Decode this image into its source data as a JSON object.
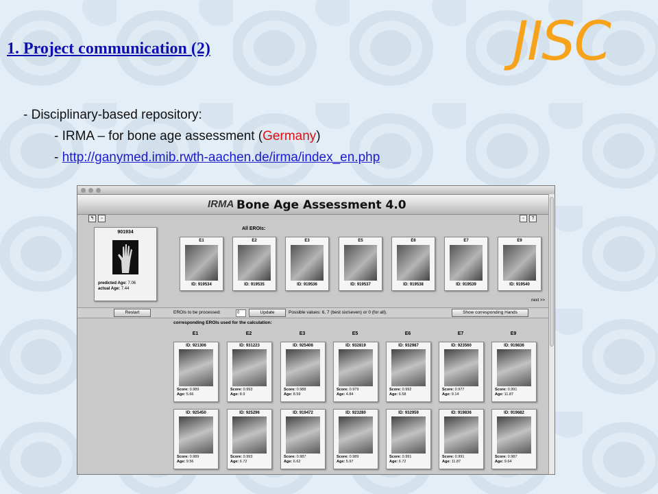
{
  "slide": {
    "title": "1. Project communication (2)",
    "logo_text": "JISC",
    "bullet1": "-  Disciplinary-based  repository:",
    "bullet2_pre": "- IRMA – for bone age assessment (",
    "bullet2_red": "Germany",
    "bullet2_post": ")",
    "bullet3_dash": "- ",
    "bullet3_link": "http://ganymed.imib.rwth-aachen.de/irma/index_en.php",
    "colors": {
      "title": "#1010b0",
      "logo": "#f7a21b",
      "red": "#e01010",
      "link": "#1a1ad0"
    }
  },
  "app": {
    "logo": "IRMA",
    "title": "Bone Age Assessment 4.0",
    "toolbar_icons": [
      "back-icon",
      "print-icon",
      "settings-icon",
      "help-icon"
    ],
    "patient": {
      "id": "901934",
      "predicted_label": "predicted Age:",
      "predicted": "7.06",
      "actual_label": "actual Age:",
      "actual": "7.44"
    },
    "all_erois_label": "All EROIs:",
    "erois": [
      {
        "label": "E1",
        "id": "ID: 919534"
      },
      {
        "label": "E2",
        "id": "ID: 919535"
      },
      {
        "label": "E3",
        "id": "ID: 919536"
      },
      {
        "label": "E5",
        "id": "ID: 919537"
      },
      {
        "label": "E6",
        "id": "ID: 919538"
      },
      {
        "label": "E7",
        "id": "ID: 919539"
      },
      {
        "label": "E9",
        "id": "ID: 919540"
      }
    ],
    "next": "next >>",
    "restart": "Restart",
    "process_label": "EROIs to be processed:",
    "process_value": "0",
    "update": "Update",
    "possible": "Possible values: 6, 7 (best six/seven) or 0 (for all).",
    "show_hands": "Show corresponding Hands",
    "corresponding_label": "corresponding EROIs used for the calculation:",
    "columns": [
      "E1",
      "E2",
      "E3",
      "E5",
      "E6",
      "E7",
      "E9"
    ],
    "score_label": "Score:",
    "age_label": "Age:",
    "rows": [
      [
        {
          "id": "ID: 921306",
          "score": "0.989",
          "age": "5.66"
        },
        {
          "id": "ID: 931223",
          "score": "0.993",
          "age": "8.9"
        },
        {
          "id": "ID: 925408",
          "score": "0.988",
          "age": "8.59"
        },
        {
          "id": "ID: 932819",
          "score": "0.979",
          "age": "4.84"
        },
        {
          "id": "ID: 932987",
          "score": "0.992",
          "age": "6.58"
        },
        {
          "id": "ID: 923560",
          "score": "0.977",
          "age": "9.14"
        },
        {
          "id": "ID: 919836",
          "score": "0.991",
          "age": "11.87"
        }
      ],
      [
        {
          "id": "ID: 925450",
          "score": "0.989",
          "age": "9.56"
        },
        {
          "id": "ID: 925296",
          "score": "0.993",
          "age": "6.72"
        },
        {
          "id": "ID: 919472",
          "score": "0.987",
          "age": "6.62"
        },
        {
          "id": "ID: 923280",
          "score": "0.989",
          "age": "5.97"
        },
        {
          "id": "ID: 932959",
          "score": "0.991",
          "age": "6.72"
        },
        {
          "id": "ID: 919836",
          "score": "0.991",
          "age": "11.87"
        },
        {
          "id": "ID: 919682",
          "score": "0.987",
          "age": "9.64"
        }
      ]
    ]
  }
}
